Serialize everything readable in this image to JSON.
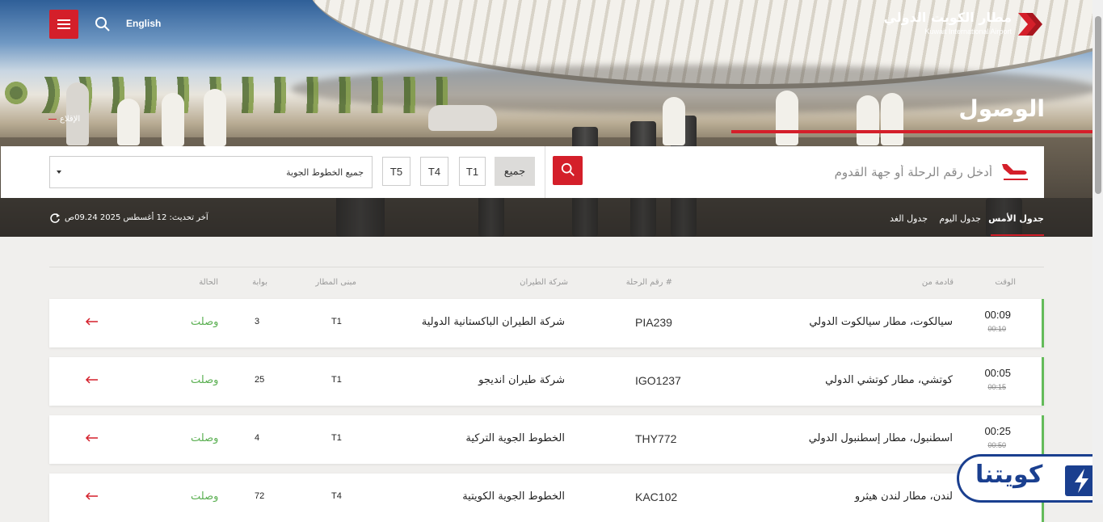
{
  "header": {
    "language_label": "English",
    "logo_ar": "مطار الكويت الدولي",
    "logo_en": "Kuwait International Airport",
    "page_title": "الوصول",
    "departures_link": "الإقلاع"
  },
  "search": {
    "placeholder": "أدخل رقم الرحلة أو جهة القدوم",
    "terminals": [
      "جميع",
      "T1",
      "T4",
      "T5"
    ],
    "airline_selected": "جميع الخطوط الجوية"
  },
  "day_tabs": [
    "جدول الأمس",
    "جدول اليوم",
    "جدول الغد"
  ],
  "last_updated": "آخر تحديث: 12 أغسطس 2025 09.24ص",
  "table": {
    "headers": {
      "time": "الوقت",
      "origin": "قادمة من",
      "flight": "رقم الرحلة #",
      "airline": "شركة الطيران",
      "terminal": "مبنى المطار",
      "gate": "بوابة",
      "status": "الحالة"
    },
    "rows": [
      {
        "time": "00:09",
        "scheduled": "00:10",
        "origin": "سيالكوت، مطار سيالكوت الدولي",
        "flight": "PIA239",
        "airline": "شركة الطيران الباكستانية الدولية",
        "terminal": "T1",
        "gate": "3",
        "status": "وصلت"
      },
      {
        "time": "00:05",
        "scheduled": "00:15",
        "origin": "كوتشي، مطار كوتشي الدولي",
        "flight": "IGO1237",
        "airline": "شركة طيران انديجو",
        "terminal": "T1",
        "gate": "25",
        "status": "وصلت"
      },
      {
        "time": "00:25",
        "scheduled": "00:50",
        "origin": "اسطنبول، مطار إسطنبول الدولي",
        "flight": "THY772",
        "airline": "الخطوط الجوية التركية",
        "terminal": "T1",
        "gate": "4",
        "status": "وصلت"
      },
      {
        "time": "",
        "scheduled": "",
        "origin": "لندن، مطار لندن هيثرو",
        "flight": "KAC102",
        "airline": "الخطوط الجوية الكويتية",
        "terminal": "T4",
        "gate": "72",
        "status": "وصلت"
      }
    ]
  },
  "badge": {
    "text": "كويتنا"
  },
  "colors": {
    "brand_red": "#d41f2a",
    "status_green": "#5aaf51",
    "badge_blue": "#1a3f8f"
  }
}
